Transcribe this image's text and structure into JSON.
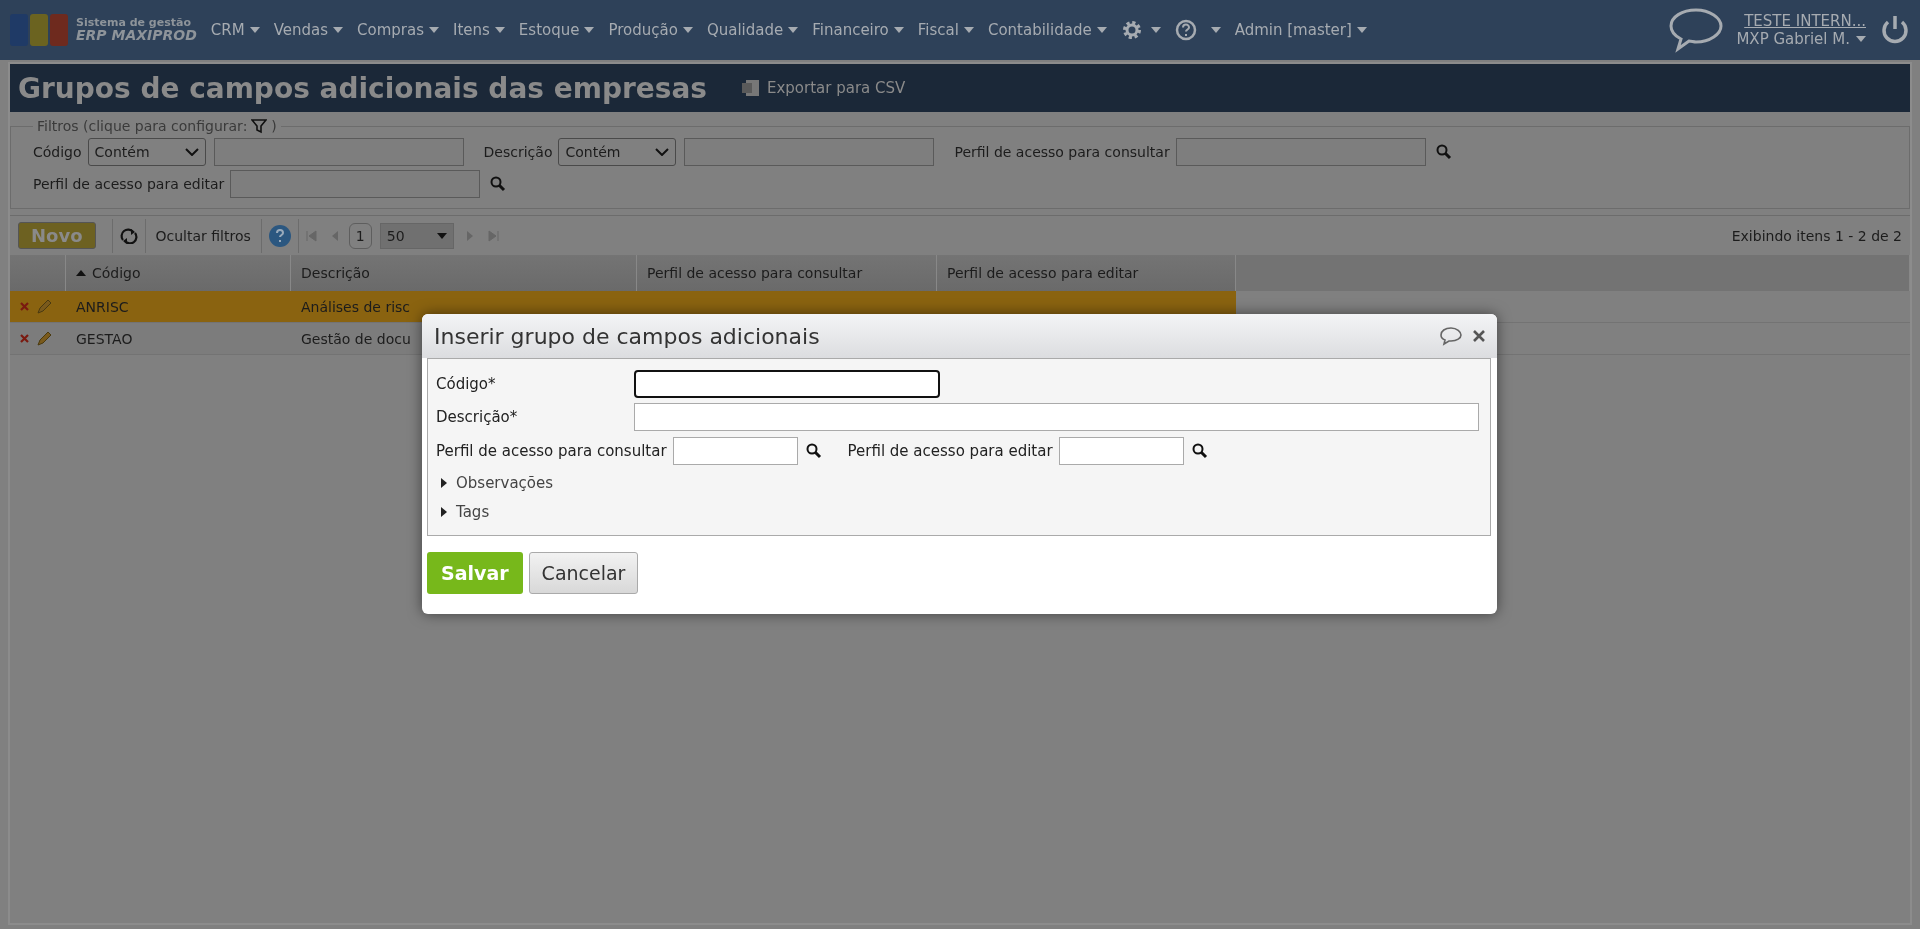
{
  "nav": {
    "brand_top": "Sistema de gestão",
    "brand_bottom": "ERP MAXIPROD",
    "menus": [
      "CRM",
      "Vendas",
      "Compras",
      "Itens",
      "Estoque",
      "Produção",
      "Qualidade",
      "Financeiro",
      "Fiscal",
      "Contabilidade"
    ],
    "admin": "Admin [master]",
    "company": "TESTE INTERN...",
    "user": "MXP Gabriel M."
  },
  "page": {
    "title": "Grupos de campos adicionais das empresas",
    "export": "Exportar para CSV"
  },
  "filters": {
    "legend": "Filtros (clique para configurar:",
    "legend_end": ")",
    "rows": [
      [
        {
          "kind": "select",
          "label": "Código",
          "option": "Contém"
        },
        {
          "kind": "select",
          "label": "Descrição",
          "option": "Contém"
        },
        {
          "kind": "lookup",
          "label": "Perfil de acesso para consultar"
        }
      ],
      [
        {
          "kind": "lookup",
          "label": "Perfil de acesso para editar"
        }
      ]
    ]
  },
  "toolbar": {
    "new": "Novo",
    "hide_filters": "Ocultar filtros",
    "page": "1",
    "per_page": "50",
    "showing": "Exibindo itens 1 - 2 de 2"
  },
  "table": {
    "columns": [
      {
        "label": "Código",
        "sorted": true
      },
      {
        "label": "Descrição",
        "sorted": false
      },
      {
        "label": "Perfil de acesso para consultar",
        "sorted": false
      },
      {
        "label": "Perfil de acesso para editar",
        "sorted": false
      }
    ],
    "rows": [
      {
        "code": "ANRISC",
        "description": "Análises de risc",
        "selected": true
      },
      {
        "code": "GESTAO",
        "description": "Gestão de docu",
        "selected": false
      }
    ]
  },
  "dialog": {
    "title": "Inserir grupo de campos adicionais",
    "code_label": "Código*",
    "description_label": "Descrição*",
    "view_label": "Perfil de acesso para consultar",
    "edit_label": "Perfil de acesso para editar",
    "sections": [
      {
        "label": "Observações",
        "expanded": false
      },
      {
        "label": "Tags",
        "expanded": false
      }
    ],
    "save": "Salvar",
    "cancel": "Cancelar"
  }
}
